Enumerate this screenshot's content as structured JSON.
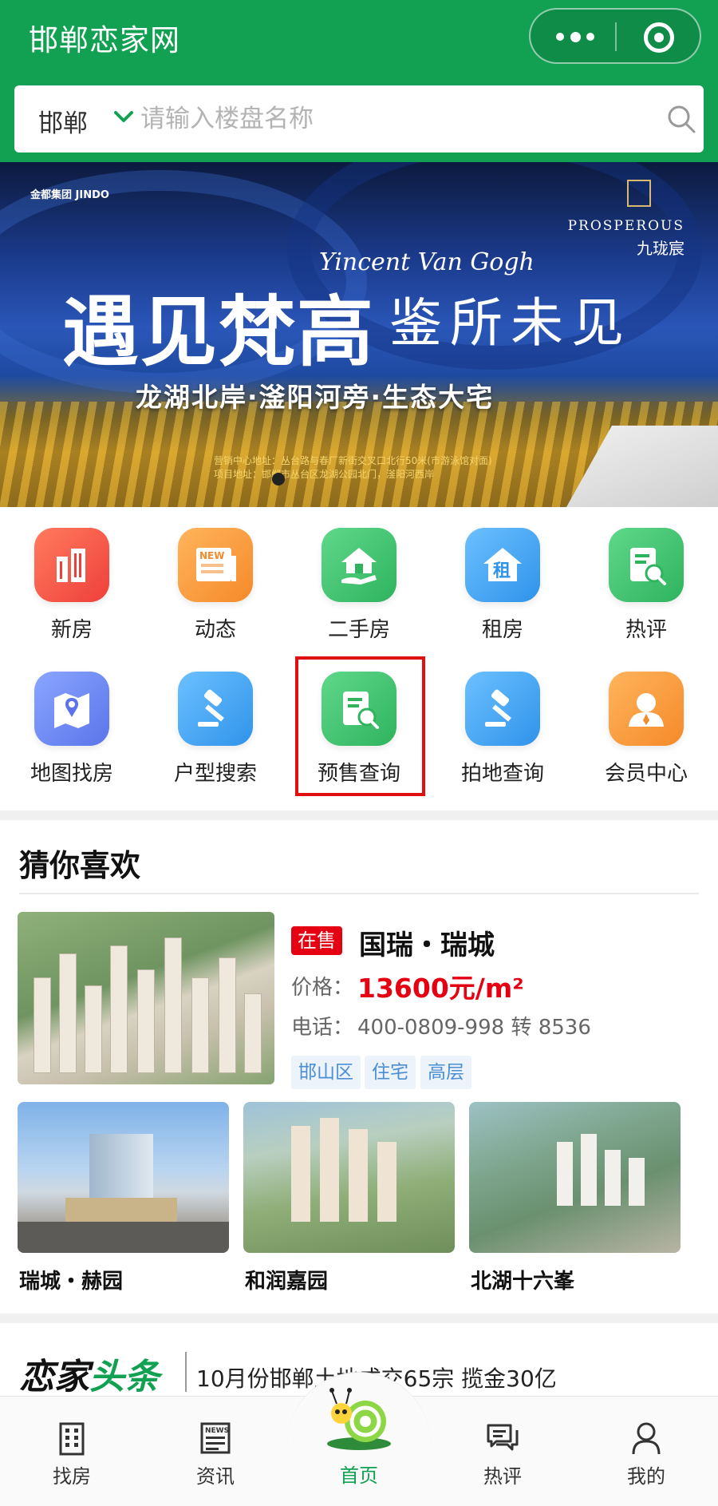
{
  "header": {
    "title": "邯郸恋家网",
    "more_icon": "more-dots-icon",
    "close_icon": "target-circle-icon"
  },
  "search": {
    "city": "邯郸",
    "placeholder": "请输入楼盘名称"
  },
  "banner": {
    "brand_left": "金都集团 JINDO",
    "brand_right_en": "PROSPEROUS",
    "brand_right_cn": "九珑宸",
    "script_text": "Yincent Van Gogh",
    "headline_left": "遇见梵高",
    "headline_right": "鉴所未见",
    "subline": "龙湖北岸·滏阳河旁·生态大宅",
    "small_line1": "营销中心地址：丛台路与春厂新街交叉口北行50米(市游泳馆对面)",
    "small_line2": "项目地址：邯郸市丛台区龙湖公园北门，滏阳河西岸"
  },
  "menu": [
    {
      "label": "新房",
      "icon": "building-icon",
      "color": "#f2564a"
    },
    {
      "label": "动态",
      "icon": "news-icon",
      "color": "#f79a3a"
    },
    {
      "label": "二手房",
      "icon": "house-hand-icon",
      "color": "#3ec46d"
    },
    {
      "label": "租房",
      "icon": "rent-house-icon",
      "color": "#43a7f0"
    },
    {
      "label": "热评",
      "icon": "review-search-icon",
      "color": "#3ec46d"
    },
    {
      "label": "地图找房",
      "icon": "map-pin-icon",
      "color": "#6d8cf2"
    },
    {
      "label": "户型搜索",
      "icon": "gavel-icon",
      "color": "#43a7f0"
    },
    {
      "label": "预售查询",
      "icon": "presale-search-icon",
      "color": "#3ec46d"
    },
    {
      "label": "拍地查询",
      "icon": "gavel-icon",
      "color": "#43a7f0"
    },
    {
      "label": "会员中心",
      "icon": "member-icon",
      "color": "#f79a3a"
    }
  ],
  "guess": {
    "title": "猜你喜欢",
    "featured": {
      "badge": "在售",
      "name": "国瑞・瑞城",
      "price_label": "价格：",
      "price_value": "13600元/m²",
      "phone_label": "电话：",
      "phone_value": "400-0809-998 转 8536",
      "tags": [
        "邯山区",
        "住宅",
        "高层"
      ]
    },
    "cards": [
      {
        "name": "瑞城・赫园"
      },
      {
        "name": "和润嘉园"
      },
      {
        "name": "北湖十六峯"
      }
    ]
  },
  "news": {
    "logo_main": "恋家",
    "logo_accent": "头条",
    "headline": "10月份邯郸土地成交65宗 揽金30亿"
  },
  "tabs": [
    {
      "label": "找房",
      "icon": "building-outline-icon"
    },
    {
      "label": "资讯",
      "icon": "newspaper-icon"
    },
    {
      "label": "首页",
      "icon": "snail-mascot-icon"
    },
    {
      "label": "热评",
      "icon": "chat-bubbles-icon"
    },
    {
      "label": "我的",
      "icon": "user-icon"
    }
  ],
  "colors": {
    "brand_green": "#12a152",
    "price_red": "#e50012",
    "tag_blue": "#4a8ed3",
    "highlight_red": "#e01010"
  }
}
